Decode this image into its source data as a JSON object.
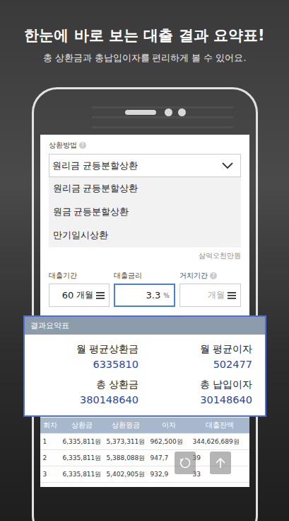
{
  "headline": "한눈에 바로 보는 대출 결과 요약표!",
  "subtitle": "총 상환금과 총납입이자를 편리하게 볼 수 있어요.",
  "repayment": {
    "label": "상환방법",
    "help": "?",
    "value": "원리금 균등분할상환",
    "options": [
      "원리금 균등분할상환",
      "원금 균등분할상환",
      "만기일시상환"
    ]
  },
  "amount_words": "삼억오천만원",
  "fields": [
    {
      "label": "대출기간",
      "help": "",
      "value": "60",
      "unit": "개월",
      "kind": "select",
      "focused": false
    },
    {
      "label": "대출금리",
      "help": "",
      "value": "3.3",
      "unit": "%",
      "kind": "input",
      "focused": true
    },
    {
      "label": "거치기간",
      "help": "?",
      "value": "",
      "unit": "개월",
      "kind": "select",
      "focused": false
    }
  ],
  "summary": {
    "title": "결과요약표",
    "items": [
      {
        "label": "월 평균상환금",
        "value": "6335810"
      },
      {
        "label": "월 평균이자",
        "value": "502477"
      },
      {
        "label": "총 상환금",
        "value": "380148640"
      },
      {
        "label": "총 납입이자",
        "value": "30148640"
      }
    ]
  },
  "table": {
    "columns": [
      "회차",
      "상환금",
      "상환원금",
      "이자",
      "대출잔액"
    ],
    "rows": [
      [
        "1",
        "6,335,811원",
        "5,373,311원",
        "962,500원",
        "344,626,689원"
      ],
      [
        "2",
        "6,335,811원",
        "5,388,088원",
        "947,7",
        "39"
      ],
      [
        "3",
        "6,335,811원",
        "5,402,905원",
        "932,9",
        "33"
      ]
    ]
  }
}
